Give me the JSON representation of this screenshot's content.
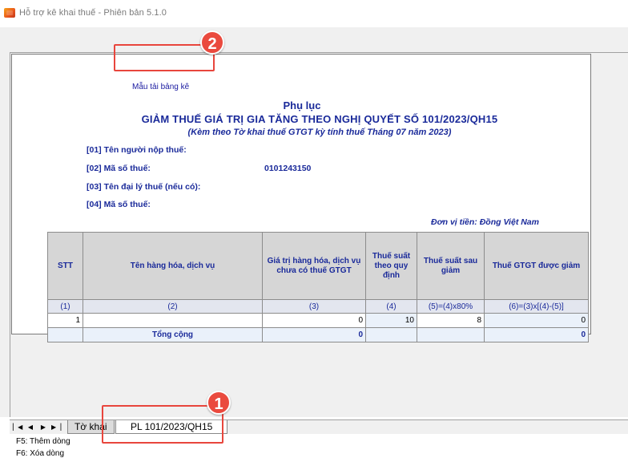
{
  "window": {
    "title": "Hỗ trợ kê khai thuế -  Phiên bản 5.1.0"
  },
  "sheet": {
    "template_link": "Mẫu tải bảng kê",
    "title_line1": "Phụ lục",
    "title_line2": "GIẢM THUẾ GIÁ TRỊ GIA TĂNG THEO NGHỊ QUYẾT SỐ 101/2023/QH15",
    "title_line3": "(Kèm theo Tờ khai thuế GTGT kỳ tính thuế  Tháng 07 năm 2023)",
    "fields": {
      "taxpayer_name": "[01] Tên người nộp thuế:",
      "tax_code_label": "[02] Mã số thuế:",
      "tax_code_value": "0101243150",
      "agent_name": "[03] Tên đại lý thuế (nếu có):",
      "agent_tax_code": "[04] Mã số thuế:"
    },
    "currency_note": "Đơn vị tiền: Đồng Việt Nam"
  },
  "table": {
    "headers": [
      "STT",
      "Tên hàng hóa, dịch vụ",
      "Giá trị hàng hóa, dịch vụ chưa có thuế GTGT",
      "Thuế suất theo quy định",
      "Thuế suất sau giảm",
      "Thuế GTGT được giảm"
    ],
    "index_row": [
      "(1)",
      "(2)",
      "(3)",
      "(4)",
      "(5)=(4)x80%",
      "(6)=(3)x[(4)-(5)]"
    ],
    "rows": [
      {
        "stt": "1",
        "name": "",
        "value": "0",
        "rate": "10",
        "reduced_rate": "8",
        "reduced_vat": "0"
      }
    ],
    "total": {
      "label": "Tổng cộng",
      "value": "0",
      "reduced_vat": "0"
    }
  },
  "tabs": {
    "tokhai": "Tờ khai",
    "pl": "PL 101/2023/QH15"
  },
  "nav_icons": [
    "first-page-icon",
    "prev-page-icon",
    "next-page-icon",
    "last-page-icon"
  ],
  "annotations": {
    "badge1": "1",
    "badge2": "2"
  },
  "hints": {
    "add_row": "F5: Thêm dòng",
    "delete_row": "F6: Xóa dòng"
  },
  "colors": {
    "label_blue": "#1a2a9a",
    "highlight_red": "#e8463d",
    "header_gray": "#d6d6d6"
  }
}
